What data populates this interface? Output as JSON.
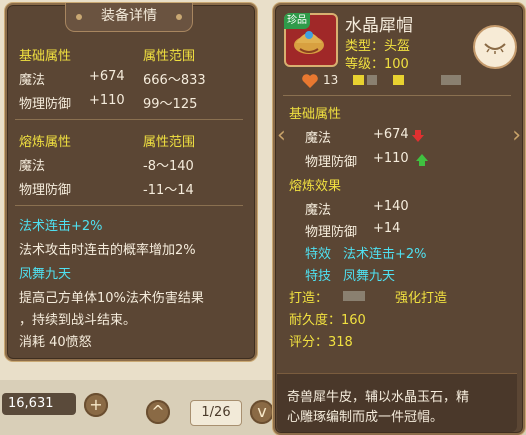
{
  "background": {
    "currency_value": "16,631",
    "plus_label": "+",
    "prev_label": "^",
    "page_indicator": "1/26",
    "next_label": "v"
  },
  "left": {
    "title": "装备详情",
    "basic": {
      "header": "基础属性",
      "range_header": "属性范围",
      "rows": [
        {
          "name": "魔法",
          "value": "+674",
          "range": "666～833"
        },
        {
          "name": "物理防御",
          "value": "+110",
          "range": "99～125"
        }
      ]
    },
    "refine": {
      "header": "熔炼属性",
      "range_header": "属性范围",
      "rows": [
        {
          "name": "魔法",
          "range": "-8～140"
        },
        {
          "name": "物理防御",
          "range": "-11～14"
        }
      ]
    },
    "spell_name": "法术连击+2%",
    "spell_desc": "法术攻击时连击的概率增加2%",
    "skill_name": "凤舞九天",
    "skill_desc_1": "提高己方单体10%法术伤害结果",
    "skill_desc_2": "，持续到战斗结束。",
    "cost": "消耗 40愤怒"
  },
  "right": {
    "badge": "珍品",
    "item_name": "水晶犀帽",
    "type_line": "类型：头盔",
    "level_line": "等级：100",
    "likes": "13",
    "basic_header": "基础属性",
    "basic_rows": [
      {
        "name": "魔法",
        "value": "+674",
        "trend": "down"
      },
      {
        "name": "物理防御",
        "value": "+110",
        "trend": "up"
      }
    ],
    "refine_header": "熔炼效果",
    "refine_rows": [
      {
        "name": "魔法",
        "value": "+140"
      },
      {
        "name": "物理防御",
        "value": "+14"
      }
    ],
    "special_effect_label": "特效",
    "special_effect_value": "法术连击+2%",
    "special_skill_label": "特技",
    "special_skill_value": "凤舞九天",
    "forge_label": "打造：",
    "forge_value": "强化打造",
    "durability": "耐久度：160",
    "score": "评分：318",
    "description_1": "奇兽犀牛皮，辅以水晶玉石，精",
    "description_2": "心雕琢编制而成一件冠帽。"
  },
  "colors": {
    "panel_bg": "#5b4634",
    "yellow": "#f0e040",
    "cyan": "#4fe0f0",
    "down_red": "#e03030",
    "up_green": "#40c040"
  }
}
